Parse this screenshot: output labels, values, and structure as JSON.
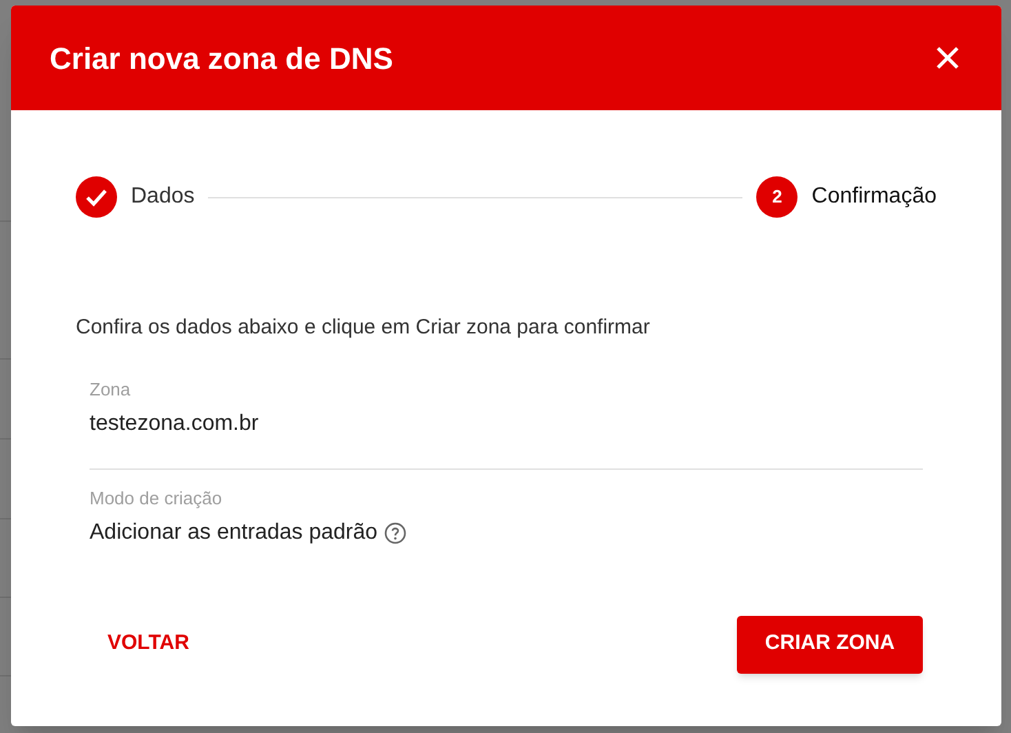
{
  "dialog": {
    "title": "Criar nova zona de DNS"
  },
  "steps": [
    {
      "label": "Dados",
      "completed": true
    },
    {
      "label": "Confirmação",
      "number": "2",
      "completed": false
    }
  ],
  "instruction": "Confira os dados abaixo e clique em Criar zona para confirmar",
  "fields": [
    {
      "label": "Zona",
      "value": "testezona.com.br",
      "help": false
    },
    {
      "label": "Modo de criação",
      "value": "Adicionar as entradas padrão",
      "help": true
    }
  ],
  "buttons": [
    {
      "label": "VOLTAR",
      "kind": "text"
    },
    {
      "label": "CRIAR ZONA",
      "kind": "primary"
    }
  ]
}
